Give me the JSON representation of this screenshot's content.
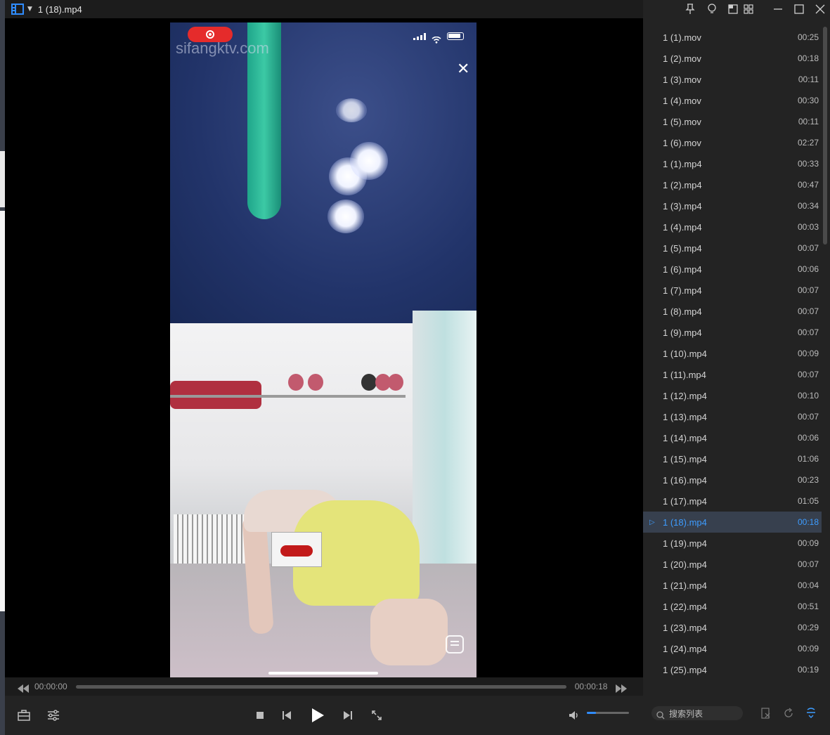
{
  "window": {
    "title": "1 (18).mp4"
  },
  "overlay": {
    "watermark": "sifangktv.com",
    "close_glyph": "✕"
  },
  "progress": {
    "current_time": "00:00:00",
    "total_time": "00:00:18",
    "position_fraction": 0.0
  },
  "volume": {
    "level_fraction": 0.22
  },
  "colors": {
    "accent": "#3d9cff",
    "panel_bg": "#232323",
    "active_row_bg": "#37404e"
  },
  "playlist": {
    "items": [
      {
        "name": "1 (1).mov",
        "duration": "00:25"
      },
      {
        "name": "1 (2).mov",
        "duration": "00:18"
      },
      {
        "name": "1 (3).mov",
        "duration": "00:11"
      },
      {
        "name": "1 (4).mov",
        "duration": "00:30"
      },
      {
        "name": "1 (5).mov",
        "duration": "00:11"
      },
      {
        "name": "1 (6).mov",
        "duration": "02:27"
      },
      {
        "name": "1 (1).mp4",
        "duration": "00:33"
      },
      {
        "name": "1 (2).mp4",
        "duration": "00:47"
      },
      {
        "name": "1 (3).mp4",
        "duration": "00:34"
      },
      {
        "name": "1 (4).mp4",
        "duration": "00:03"
      },
      {
        "name": "1 (5).mp4",
        "duration": "00:07"
      },
      {
        "name": "1 (6).mp4",
        "duration": "00:06"
      },
      {
        "name": "1 (7).mp4",
        "duration": "00:07"
      },
      {
        "name": "1 (8).mp4",
        "duration": "00:07"
      },
      {
        "name": "1 (9).mp4",
        "duration": "00:07"
      },
      {
        "name": "1 (10).mp4",
        "duration": "00:09"
      },
      {
        "name": "1 (11).mp4",
        "duration": "00:07"
      },
      {
        "name": "1 (12).mp4",
        "duration": "00:10"
      },
      {
        "name": "1 (13).mp4",
        "duration": "00:07"
      },
      {
        "name": "1 (14).mp4",
        "duration": "00:06"
      },
      {
        "name": "1 (15).mp4",
        "duration": "01:06"
      },
      {
        "name": "1 (16).mp4",
        "duration": "00:23"
      },
      {
        "name": "1 (17).mp4",
        "duration": "01:05"
      },
      {
        "name": "1 (18).mp4",
        "duration": "00:18",
        "active": true
      },
      {
        "name": "1 (19).mp4",
        "duration": "00:09"
      },
      {
        "name": "1 (20).mp4",
        "duration": "00:07"
      },
      {
        "name": "1 (21).mp4",
        "duration": "00:04"
      },
      {
        "name": "1 (22).mp4",
        "duration": "00:51"
      },
      {
        "name": "1 (23).mp4",
        "duration": "00:29"
      },
      {
        "name": "1 (24).mp4",
        "duration": "00:09"
      },
      {
        "name": "1 (25).mp4",
        "duration": "00:19"
      }
    ]
  },
  "search": {
    "placeholder": "搜索列表"
  },
  "icons": {
    "window_controls": [
      "pin-icon",
      "bulb-icon",
      "mini-mode-icon",
      "layout-icon",
      "minimize-icon",
      "maximize-icon",
      "close-icon"
    ],
    "controls": [
      "toolbox-icon",
      "settings-sliders-icon",
      "stop-icon",
      "previous-icon",
      "play-icon",
      "next-icon",
      "fullscreen-icon",
      "volume-icon"
    ],
    "panel_bottom": [
      "clear-list-icon",
      "loop-icon",
      "sort-icon"
    ]
  }
}
